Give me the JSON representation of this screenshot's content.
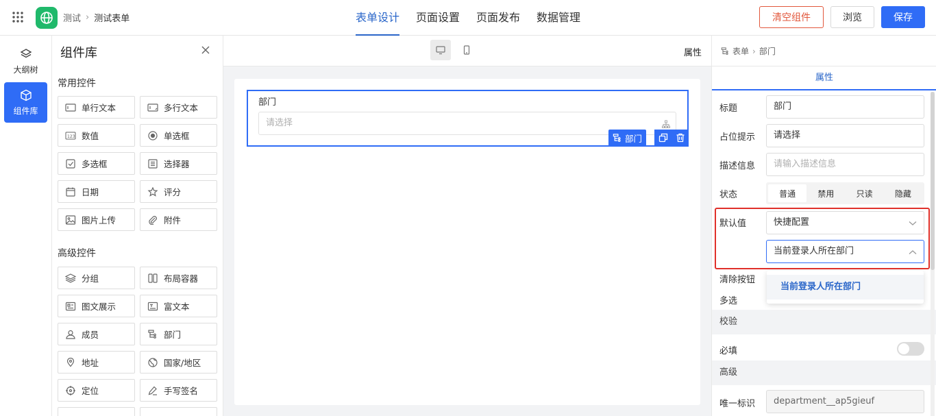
{
  "header": {
    "breadcrumb": [
      "测试",
      "测试表单"
    ],
    "tabs": [
      "表单设计",
      "页面设置",
      "页面发布",
      "数据管理"
    ],
    "active_tab": 0,
    "buttons": {
      "clear": "清空组件",
      "preview": "浏览",
      "save": "保存"
    },
    "accent_color": "#2f6cf6"
  },
  "rail": {
    "items": [
      {
        "label": "大纲树",
        "icon": "layers-icon"
      },
      {
        "label": "组件库",
        "icon": "cube-icon",
        "active": true
      }
    ]
  },
  "library": {
    "title": "组件库",
    "common_title": "常用控件",
    "common": [
      {
        "label": "单行文本",
        "icon": "single-line-text-icon"
      },
      {
        "label": "多行文本",
        "icon": "multi-line-text-icon"
      },
      {
        "label": "数值",
        "icon": "number-icon"
      },
      {
        "label": "单选框",
        "icon": "radio-icon"
      },
      {
        "label": "多选框",
        "icon": "checkbox-icon"
      },
      {
        "label": "选择器",
        "icon": "select-icon"
      },
      {
        "label": "日期",
        "icon": "calendar-icon"
      },
      {
        "label": "评分",
        "icon": "star-icon"
      },
      {
        "label": "图片上传",
        "icon": "image-icon"
      },
      {
        "label": "附件",
        "icon": "paperclip-icon"
      }
    ],
    "advanced_title": "高级控件",
    "advanced": [
      {
        "label": "分组",
        "icon": "layers-icon"
      },
      {
        "label": "布局容器",
        "icon": "columns-icon"
      },
      {
        "label": "图文展示",
        "icon": "card-icon"
      },
      {
        "label": "富文本",
        "icon": "rich-text-icon"
      },
      {
        "label": "成员",
        "icon": "user-icon"
      },
      {
        "label": "部门",
        "icon": "department-icon"
      },
      {
        "label": "地址",
        "icon": "map-pin-icon"
      },
      {
        "label": "国家/地区",
        "icon": "globe-icon"
      },
      {
        "label": "定位",
        "icon": "crosshair-icon"
      },
      {
        "label": "手写签名",
        "icon": "pen-icon"
      }
    ]
  },
  "canvas": {
    "properties_label": "属性",
    "field": {
      "label": "部门",
      "placeholder": "请选择",
      "tag": "部门"
    }
  },
  "properties": {
    "breadcrumb": [
      "表单",
      "部门"
    ],
    "tab": "属性",
    "title_label": "标题",
    "title_value": "部门",
    "placeholder_label": "占位提示",
    "placeholder_value": "请选择",
    "desc_label": "描述信息",
    "desc_placeholder": "请输入描述信息",
    "status_label": "状态",
    "status_options": [
      "普通",
      "禁用",
      "只读",
      "隐藏"
    ],
    "status_selected": 0,
    "default_label": "默认值",
    "default_mode": "快捷配置",
    "default_value": "当前登录人所在部门",
    "dropdown_option": "当前登录人所在部门",
    "clear_label": "清除按钮",
    "multi_label": "多选",
    "validate_section": "校验",
    "required_label": "必填",
    "advanced_section": "高级",
    "id_label": "唯一标识",
    "id_value": "department__ap5gieuf"
  }
}
